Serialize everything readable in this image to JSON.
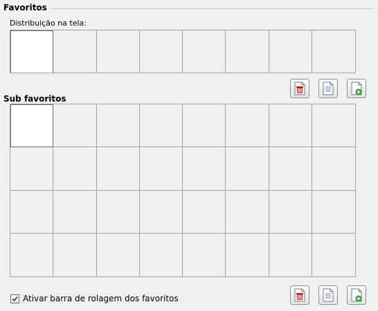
{
  "favoritos": {
    "title": "Favoritos",
    "distribution_label": "Distribuição na tela:",
    "grid": {
      "rows": 1,
      "cols": 8,
      "selected_index": 0
    }
  },
  "sub_favoritos": {
    "title": "Sub favoritos",
    "grid": {
      "rows": 4,
      "cols": 8,
      "selected_index": 0
    }
  },
  "checkbox": {
    "label": "Ativar barra de rolagem dos favoritos",
    "checked": true
  },
  "icons": {
    "delete": "delete-page-icon",
    "edit": "edit-page-icon",
    "add": "add-page-icon"
  },
  "colors": {
    "delete_accent": "#e03030",
    "edit_accent": "#3a80c8",
    "add_accent": "#2aa02a"
  }
}
